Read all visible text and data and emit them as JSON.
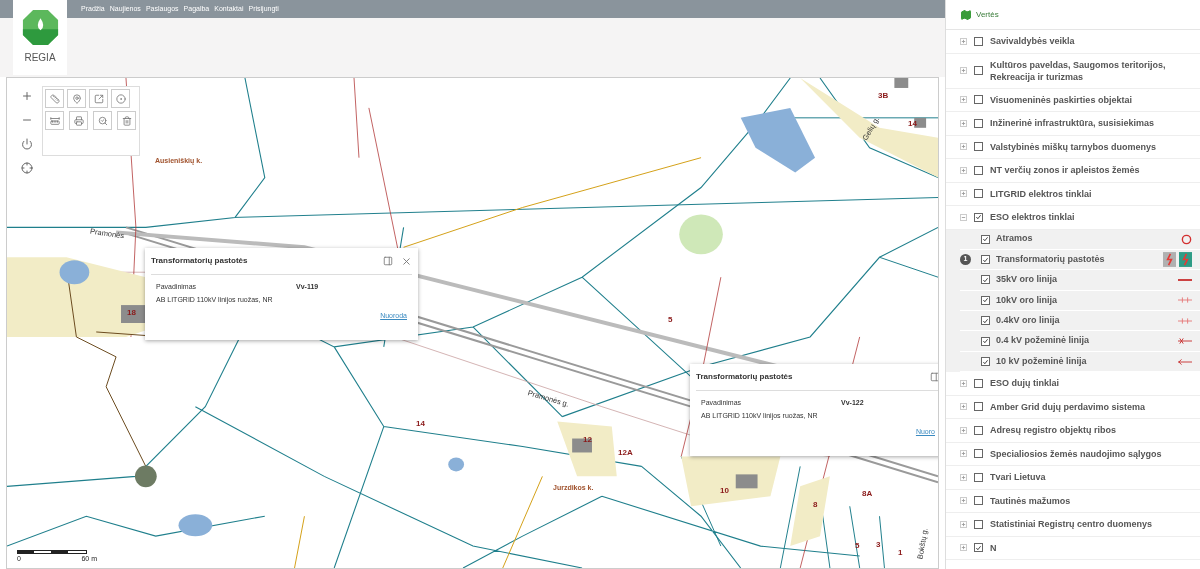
{
  "nav": {
    "logo_text": "REGIA",
    "items": [
      "Pradžia",
      "Naujienos",
      "Paslaugos",
      "Pagalba",
      "Kontaktai",
      "Prisijungti"
    ]
  },
  "map": {
    "labels": [
      {
        "text": "Ausieniškių k.",
        "kind": "place"
      },
      {
        "text": "Pramonės",
        "kind": "street"
      },
      {
        "text": "Pramonės g.",
        "kind": "street"
      },
      {
        "text": "Gelių g.",
        "kind": "street"
      },
      {
        "text": "Jurzdikos k.",
        "kind": "place"
      },
      {
        "text": "5",
        "kind": "parcel"
      },
      {
        "text": "14",
        "kind": "parcel"
      },
      {
        "text": "12",
        "kind": "parcel"
      },
      {
        "text": "12A",
        "kind": "parcel"
      },
      {
        "text": "10",
        "kind": "parcel"
      },
      {
        "text": "8A",
        "kind": "parcel"
      },
      {
        "text": "3B",
        "kind": "parcel"
      },
      {
        "text": "14",
        "kind": "parcel"
      },
      {
        "text": "18",
        "kind": "parcel"
      },
      {
        "text": "8",
        "kind": "parcel"
      },
      {
        "text": "5",
        "kind": "parcel"
      },
      {
        "text": "3",
        "kind": "parcel"
      },
      {
        "text": "1",
        "kind": "parcel"
      },
      {
        "text": "Bokštų g.",
        "kind": "street"
      }
    ],
    "scale": {
      "start": "0",
      "end": "60 m"
    },
    "popups": [
      {
        "title": "Transformatorių pastotės",
        "field_label": "Pavadinimas",
        "field_value": "Vv-119",
        "description": "AB LITGRID 110kV linijos ruožas, NR",
        "link": "Nuoroda",
        "closable": true
      },
      {
        "title": "Transformatorių pastotės",
        "field_label": "Pavadinimas",
        "field_value": "Vv-122",
        "description": "AB LITGRID 110kV linijos ruožas, NR",
        "link": "Nuoro",
        "closable": false
      }
    ]
  },
  "layers": {
    "title": "Vertės",
    "items": [
      {
        "label": "Savivaldybės veikla",
        "checked": false,
        "expanded": false
      },
      {
        "label": "Kultūros paveldas, Saugomos teritorijos, Rekreacija ir turizmas",
        "checked": false,
        "expanded": false
      },
      {
        "label": "Visuomeninės paskirties objektai",
        "checked": false,
        "expanded": false
      },
      {
        "label": "Inžinerinė infrastruktūra, susisiekimas",
        "checked": false,
        "expanded": false
      },
      {
        "label": "Valstybinės miškų tarnybos duomenys",
        "checked": false,
        "expanded": false
      },
      {
        "label": "NT verčių zonos ir apleistos žemės",
        "checked": false,
        "expanded": false
      },
      {
        "label": "LITGRID elektros tinklai",
        "checked": false,
        "expanded": false
      },
      {
        "label": "ESO elektros tinklai",
        "checked": true,
        "expanded": true,
        "children": [
          {
            "label": "Atramos",
            "checked": true,
            "kind": "circle"
          },
          {
            "label": "Transformatorių pastotės",
            "checked": true,
            "kind": "substation",
            "badge": "1"
          },
          {
            "label": "35kV oro linija",
            "checked": true,
            "kind": "solid"
          },
          {
            "label": "10kV oro linija",
            "checked": true,
            "kind": "tick"
          },
          {
            "label": "0.4kV oro linija",
            "checked": true,
            "kind": "tick"
          },
          {
            "label": "0.4 kV požeminė linija",
            "checked": true,
            "kind": "cross"
          },
          {
            "label": "10 kV požeminė linija",
            "checked": true,
            "kind": "arrow"
          }
        ]
      },
      {
        "label": "ESO dujų tinklai",
        "checked": false,
        "expanded": false
      },
      {
        "label": "Amber Grid dujų perdavimo sistema",
        "checked": false,
        "expanded": false
      },
      {
        "label": "Adresų registro objektų ribos",
        "checked": false,
        "expanded": false
      },
      {
        "label": "Specialiosios žemės naudojimo sąlygos",
        "checked": false,
        "expanded": false
      },
      {
        "label": "Tvari Lietuva",
        "checked": false,
        "expanded": false
      },
      {
        "label": "Tautinės mažumos",
        "checked": false,
        "expanded": false
      },
      {
        "label": "Statistiniai Registrų centro duomenys",
        "checked": false,
        "expanded": false
      },
      {
        "label": "N",
        "checked": true,
        "expanded": false
      }
    ]
  }
}
